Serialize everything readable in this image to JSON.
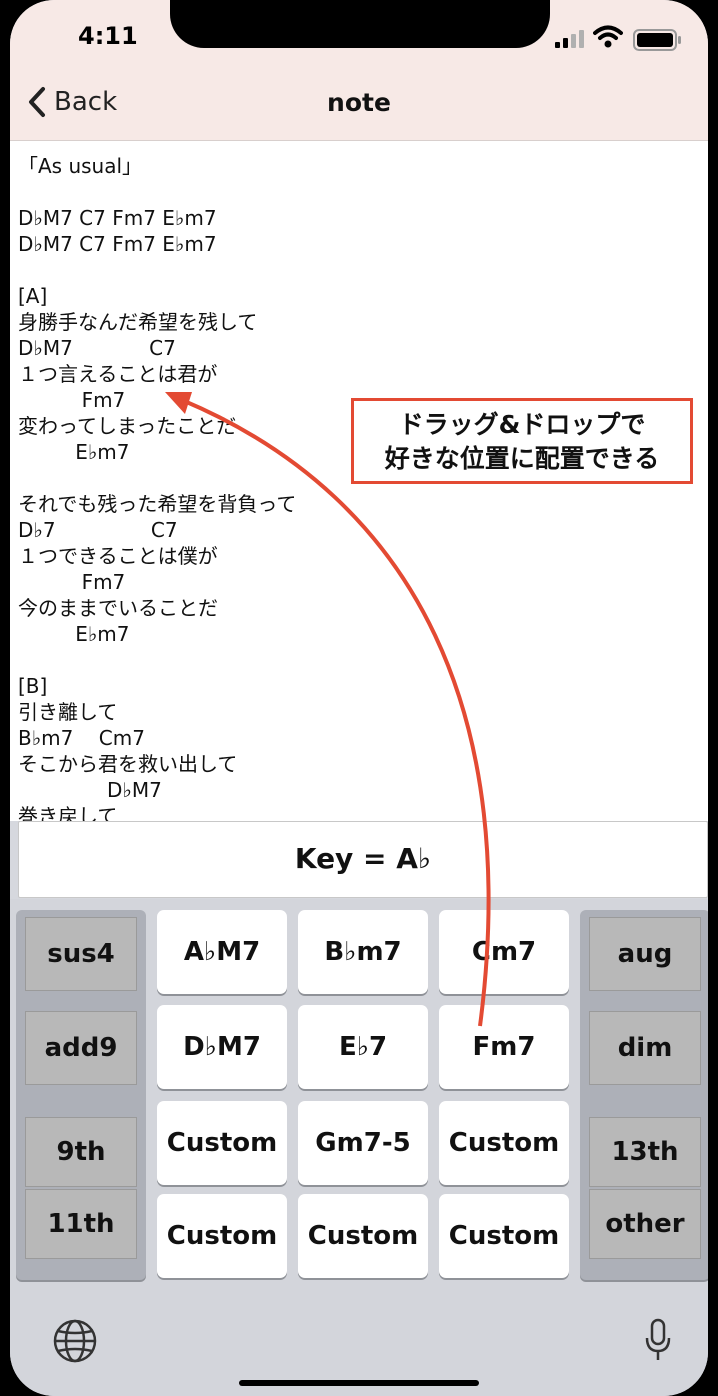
{
  "status": {
    "time": "4:11"
  },
  "nav": {
    "back_label": "Back",
    "title": "note"
  },
  "note_lines": [
    "「As usual」",
    "",
    "D♭M7 C7 Fm7 E♭m7",
    "D♭M7 C7 Fm7 E♭m7",
    "",
    "[A]",
    "身勝手なんだ希望を残して",
    "D♭M7            C7",
    "１つ言えることは君が",
    "          Fm7",
    "変わってしまったことだ",
    "         E♭m7",
    "",
    "それでも残った希望を背負って",
    "D♭7               C7",
    "１つできることは僕が",
    "          Fm7",
    "今のままでいることだ",
    "         E♭m7",
    "",
    "[B]",
    "引き離して",
    "B♭m7    Cm7",
    "そこから君を救い出して",
    "              D♭M7",
    "巻き戻して"
  ],
  "key_display": "Key = A♭",
  "chord_keys": [
    [
      "A♭M7",
      "B♭m7",
      "Cm7"
    ],
    [
      "D♭M7",
      "E♭7",
      "Fm7"
    ],
    [
      "Custom",
      "Gm7-5",
      "Custom"
    ],
    [
      "Custom",
      "Custom",
      "Custom"
    ]
  ],
  "left_keys": [
    "sus4",
    "add9",
    "9th",
    "11th"
  ],
  "right_keys": [
    "aug",
    "dim",
    "13th",
    "other"
  ],
  "icons": {
    "globe": "globe-icon",
    "mic": "microphone-icon",
    "back": "chevron-left-icon"
  },
  "callout": {
    "line1": "ドラッグ&ドロップで",
    "line2": "好きな位置に配置できる"
  },
  "colors": {
    "nav_background": "#f7e9e6",
    "annotation_red": "#e34a33",
    "keyboard_background": "#d3d5db"
  }
}
